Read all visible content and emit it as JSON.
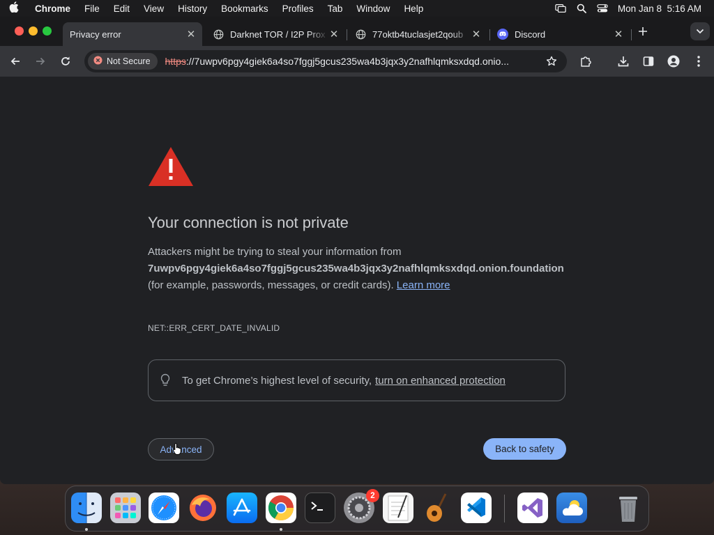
{
  "menubar": {
    "app_name": "Chrome",
    "items": [
      "File",
      "Edit",
      "View",
      "History",
      "Bookmarks",
      "Profiles",
      "Tab",
      "Window",
      "Help"
    ],
    "clock": "Mon Jan 8  5:16 AM"
  },
  "tabs": [
    {
      "title": "Privacy error",
      "icon": "none",
      "active": true
    },
    {
      "title": "Darknet TOR / I2P Prox",
      "icon": "globe-icon"
    },
    {
      "title": "77oktb4tuclasjet2qoub",
      "icon": "globe-icon"
    },
    {
      "title": "Discord",
      "icon": "discord-icon"
    }
  ],
  "toolbar": {
    "security_label": "Not Secure",
    "url_scheme": "https",
    "url_rest": "://7uwpv6pgy4giek6a4so7fggj5gcus235wa4b3jqx3y2nafhlqmksxdqd.onio..."
  },
  "page": {
    "heading": "Your connection is not private",
    "desc_prefix": "Attackers might be trying to steal your information from",
    "host": "7uwpv6pgy4giek6a4so7fggj5gcus235wa4b3jqx3y2nafhlqmksxdqd.onion.foundation",
    "desc_suffix": "(for example, passwords, messages, or credit cards).",
    "learn_more": "Learn more",
    "error_code": "NET::ERR_CERT_DATE_INVALID",
    "promo_text": "To get Chrome’s highest level of security,",
    "promo_link": "turn on enhanced protection",
    "advanced_label": "Advanced",
    "back_label": "Back to safety"
  },
  "dock": {
    "badge_count": "2"
  },
  "colors": {
    "accent": "#8ab4f8",
    "warning": "#f28b82",
    "warning_icon": "#d93025"
  }
}
